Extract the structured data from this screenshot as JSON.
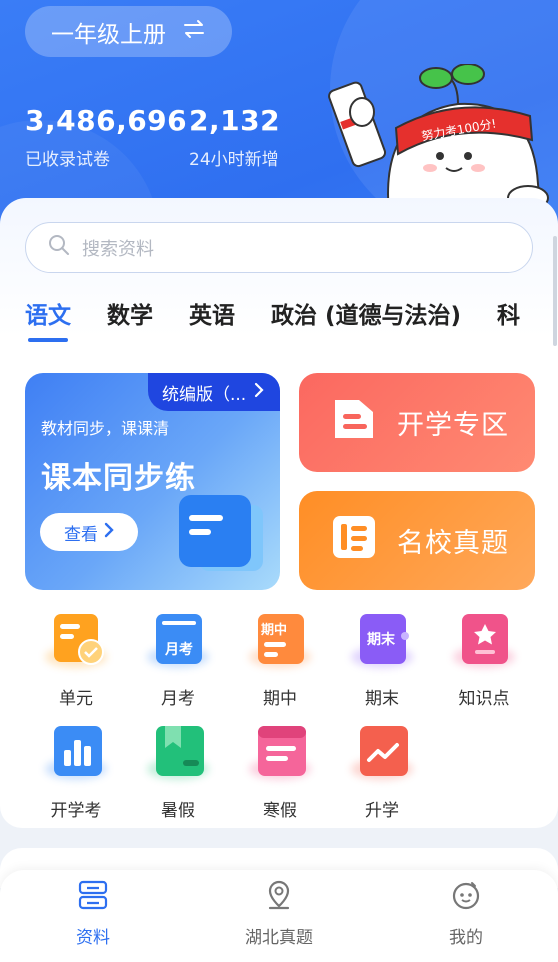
{
  "header": {
    "grade_label": "一年级上册",
    "stats": [
      {
        "value": "3,486,696",
        "label": "已收录试卷"
      },
      {
        "value": "2,132",
        "label": "24小时新增"
      }
    ],
    "mascot_banner": "努力考100分!"
  },
  "search": {
    "placeholder": "搜索资料"
  },
  "subject_tabs": [
    {
      "label": "语文",
      "active": true
    },
    {
      "label": "数学",
      "active": false
    },
    {
      "label": "英语",
      "active": false
    },
    {
      "label": "政治 (道德与法治)",
      "active": false
    },
    {
      "label": "科",
      "active": false
    }
  ],
  "banner": {
    "corner": "统编版（...",
    "subtitle": "教材同步，课课清",
    "title": "课本同步练",
    "button": "查看"
  },
  "features": [
    {
      "label": "开学专区",
      "icon": "folder-icon"
    },
    {
      "label": "名校真题",
      "icon": "notebook-icon"
    }
  ],
  "grid": [
    {
      "label": "单元",
      "badge": "",
      "color": "#ffa21f"
    },
    {
      "label": "月考",
      "badge": "月考",
      "color": "#3b8cf5"
    },
    {
      "label": "期中",
      "badge": "期中",
      "color": "#ff8a3d"
    },
    {
      "label": "期末",
      "badge": "期末",
      "color": "#8a5cf6"
    },
    {
      "label": "知识点",
      "badge": "",
      "color": "#f0538a"
    },
    {
      "label": "开学考",
      "badge": "",
      "color": "#3b8cf5"
    },
    {
      "label": "暑假",
      "badge": "",
      "color": "#22c07a"
    },
    {
      "label": "寒假",
      "badge": "",
      "color": "#f0538a"
    },
    {
      "label": "升学",
      "badge": "",
      "color": "#f4604e"
    }
  ],
  "bottom_nav": [
    {
      "label": "资料",
      "active": true,
      "icon": "documents-icon"
    },
    {
      "label": "湖北真题",
      "active": false,
      "icon": "location-icon"
    },
    {
      "label": "我的",
      "active": false,
      "icon": "profile-icon"
    }
  ],
  "colors": {
    "primary": "#2d6ff0",
    "header": "#3a7df6"
  }
}
